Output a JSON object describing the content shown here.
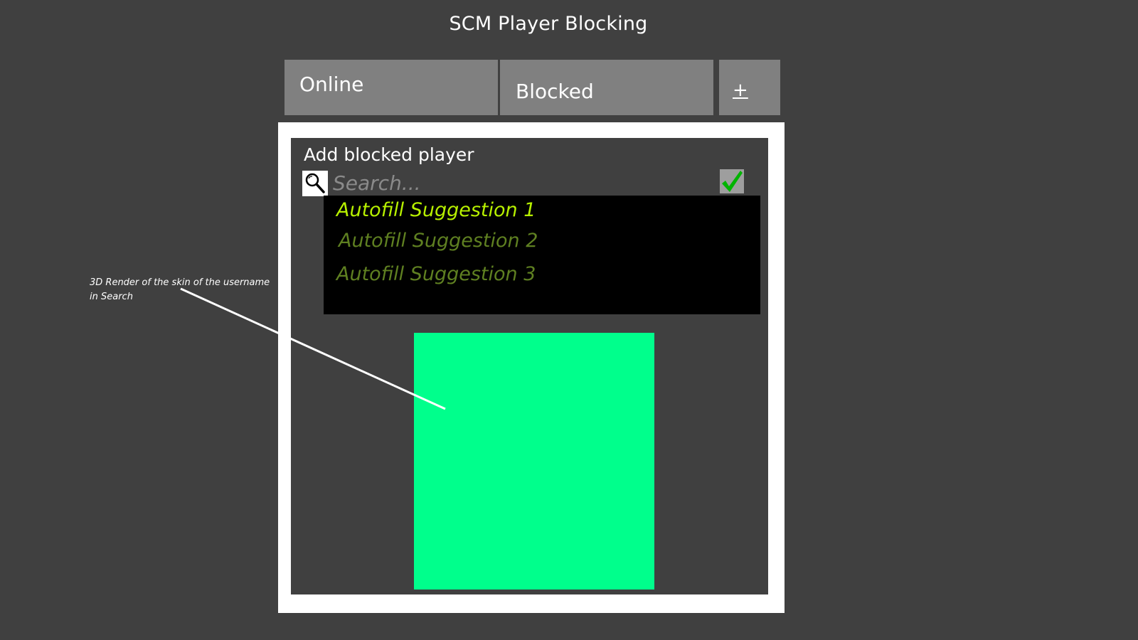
{
  "app": {
    "title": "SCM Player Blocking"
  },
  "tabs": [
    {
      "label": "Online"
    },
    {
      "label": "Blocked"
    },
    {
      "label": "+"
    }
  ],
  "panel": {
    "title": "Add blocked player",
    "search": {
      "placeholder": "Search...",
      "value": ""
    },
    "autofill": [
      {
        "label": "Autofill Suggestion 1",
        "highlighted": true
      },
      {
        "label": "Autofill Suggestion 2",
        "highlighted": false
      },
      {
        "label": "Autofill Suggestion 3",
        "highlighted": false
      }
    ]
  },
  "annotation": {
    "text": "3D Render of the skin of the username in Search"
  },
  "colors": {
    "background": "#404040",
    "tab": "#808080",
    "suggestion_highlight": "#b7f000",
    "suggestion_normal": "#5f8021",
    "skin_render": "#00ff8c",
    "check": "#00b400"
  },
  "icons": {
    "search": "magnifier-icon",
    "confirm": "checkmark-icon"
  }
}
